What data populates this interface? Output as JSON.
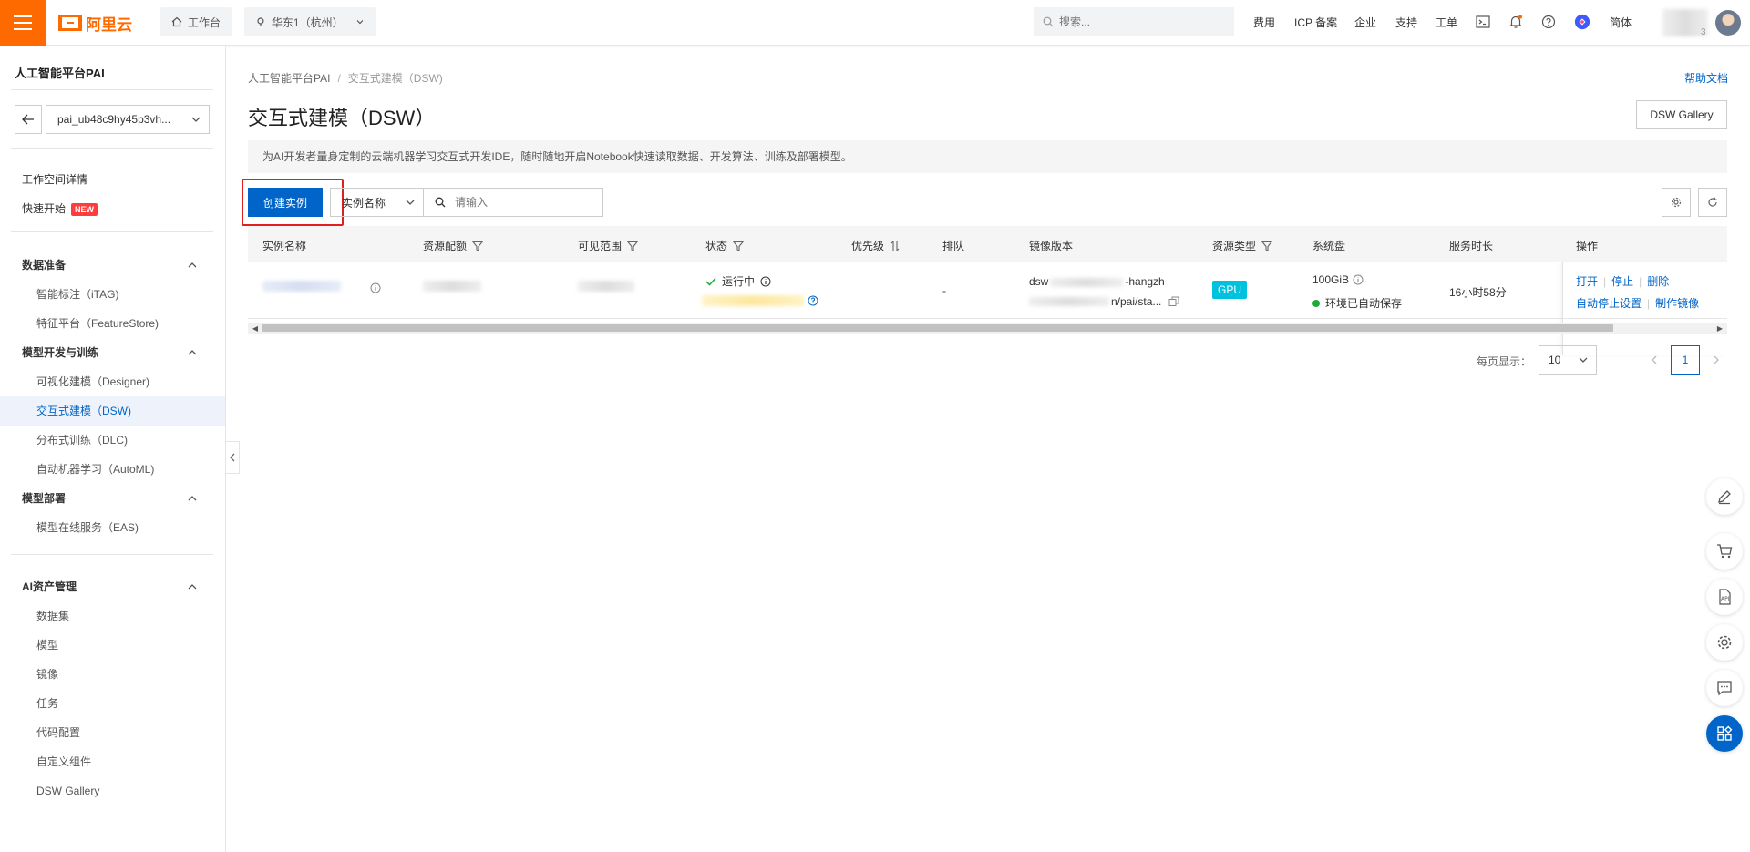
{
  "topbar": {
    "logo": "阿里云",
    "workbench": "工作台",
    "region": "华东1（杭州）",
    "search_placeholder": "搜索...",
    "links": [
      "费用",
      "ICP 备案",
      "企业",
      "支持",
      "工单"
    ],
    "lang": "简体",
    "user_badge": "3",
    "accent": "#ff6a00"
  },
  "sidebar": {
    "title": "人工智能平台PAI",
    "workspace": "pai_ub48c9hy45p3vh...",
    "workspace_detail": "工作空间详情",
    "quick_start": "快速开始",
    "new_badge": "NEW",
    "groups": {
      "data_prep": {
        "label": "数据准备",
        "items": [
          "智能标注（iTAG)",
          "特征平台（FeatureStore)"
        ]
      },
      "model_dev": {
        "label": "模型开发与训练",
        "items": [
          "可视化建模（Designer)",
          "交互式建模（DSW)",
          "分布式训练（DLC)",
          "自动机器学习（AutoML)"
        ]
      },
      "deploy": {
        "label": "模型部署",
        "items": [
          "模型在线服务（EAS)"
        ]
      },
      "assets": {
        "label": "AI资产管理",
        "items": [
          "数据集",
          "模型",
          "镜像",
          "任务",
          "代码配置",
          "自定义组件",
          "DSW Gallery"
        ]
      }
    }
  },
  "main": {
    "breadcrumb": [
      "人工智能平台PAI",
      "交互式建模（DSW)"
    ],
    "help": "帮助文档",
    "title": "交互式建模（DSW）",
    "gallery_button": "DSW Gallery",
    "description": "为AI开发者量身定制的云端机器学习交互式开发IDE，随时随地开启Notebook快速读取数据、开发算法、训练及部署模型。",
    "create_button": "创建实例",
    "filter_field": "实例名称",
    "filter_placeholder": "请输入"
  },
  "table": {
    "headers": [
      "实例名称",
      "资源配额",
      "可见范围",
      "状态",
      "优先级",
      "排队",
      "镜像版本",
      "资源类型",
      "系统盘",
      "服务时长",
      "操作"
    ],
    "row": {
      "status": "运行中",
      "queue": "-",
      "image_line1": "dsw",
      "image_line1b": "-hangzh",
      "image_line2": "n/pai/sta...",
      "resource_type": "GPU",
      "disk": "100GiB",
      "disk_status": "环境已自动保存",
      "duration": "16小时58分",
      "actions": [
        "打开",
        "停止",
        "删除",
        "自动停止设置",
        "制作镜像"
      ]
    }
  },
  "pagination": {
    "label": "每页显示：",
    "page_size": "10",
    "current_page": "1"
  }
}
